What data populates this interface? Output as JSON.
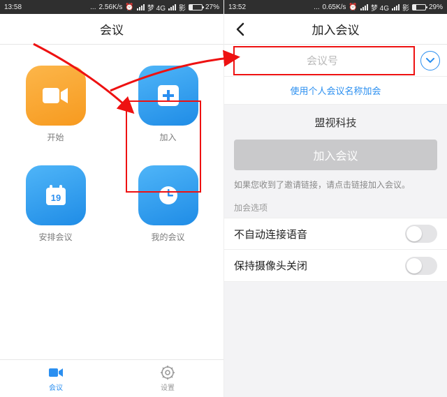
{
  "left": {
    "status": {
      "time": "13:58",
      "speed": "2.56K/s",
      "net1": "梦 4G",
      "net2": "影",
      "batt_pct": "27%",
      "batt_fill": 27
    },
    "header": {
      "title": "会议"
    },
    "tiles": {
      "start": {
        "label": "开始",
        "icon": "video-icon"
      },
      "join": {
        "label": "加入",
        "icon": "plus-icon"
      },
      "schedule": {
        "label": "安排会议",
        "icon": "calendar-icon"
      },
      "mine": {
        "label": "我的会议",
        "icon": "clock-icon"
      }
    },
    "tabs": {
      "meeting": "会议",
      "settings": "设置"
    }
  },
  "right": {
    "status": {
      "time": "13:52",
      "speed": "0.65K/s",
      "net1": "梦 4G",
      "net2": "影",
      "batt_pct": "29%",
      "batt_fill": 29
    },
    "header": {
      "title": "加入会议"
    },
    "input": {
      "placeholder": "会议号"
    },
    "link": "使用个人会议名称加会",
    "company": "盟视科技",
    "join_button": "加入会议",
    "hint": "如果您收到了邀请链接，请点击链接加入会议。",
    "section": "加会选项",
    "option_audio": "不自动连接语音",
    "option_camera": "保持摄像头关闭"
  }
}
